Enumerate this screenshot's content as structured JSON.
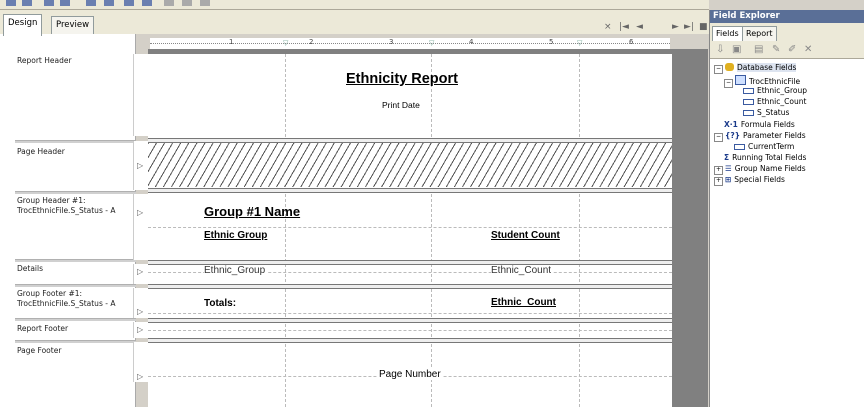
{
  "tabs": {
    "design": "Design",
    "preview": "Preview"
  },
  "nav": {
    "close": "×",
    "first": "|◄",
    "prev": "◄",
    "next": "►",
    "last": "►|",
    "stop": "■"
  },
  "ruler": {
    "ticks": [
      "1",
      "2",
      "3",
      "4",
      "5",
      "6"
    ]
  },
  "sections": {
    "report_header": "Report Header",
    "page_header": "Page Header",
    "group_header": "Group Header #1:\nTrocEthnicFile.S_Status - A",
    "details": "Details",
    "group_footer": "Group Footer #1:\nTrocEthnicFile.S_Status - A",
    "report_footer": "Report Footer",
    "page_footer": "Page Footer"
  },
  "report": {
    "title": "Ethnicity Report",
    "print_date": "Print Date",
    "group_name": "Group #1 Name",
    "ethnic_group_header": "Ethnic Group",
    "student_count_header": "Student Count",
    "ethnic_group_field": "Ethnic_Group",
    "ethnic_count_field": "Ethnic_Count",
    "totals_label": "Totals:",
    "ethnic_count_total": "Ethnic_Count",
    "page_number": "Page Number"
  },
  "field_explorer": {
    "title": "Field Explorer",
    "tabs": {
      "fields": "Fields",
      "report": "Report"
    },
    "tree": {
      "database_fields": "Database Fields",
      "table": "TrocEthnicFile",
      "fields": [
        "Ethnic_Group",
        "Ethnic_Count",
        "S_Status"
      ],
      "formula_fields": "Formula Fields",
      "parameter_fields": "Parameter Fields",
      "current_term": "CurrentTerm",
      "running_total_fields": "Running Total Fields",
      "group_name_fields": "Group Name Fields",
      "special_fields": "Special Fields"
    }
  },
  "colors": {
    "title_bar": "#5a6f97",
    "canvas_gray": "#808080",
    "chrome": "#ece9d8"
  }
}
